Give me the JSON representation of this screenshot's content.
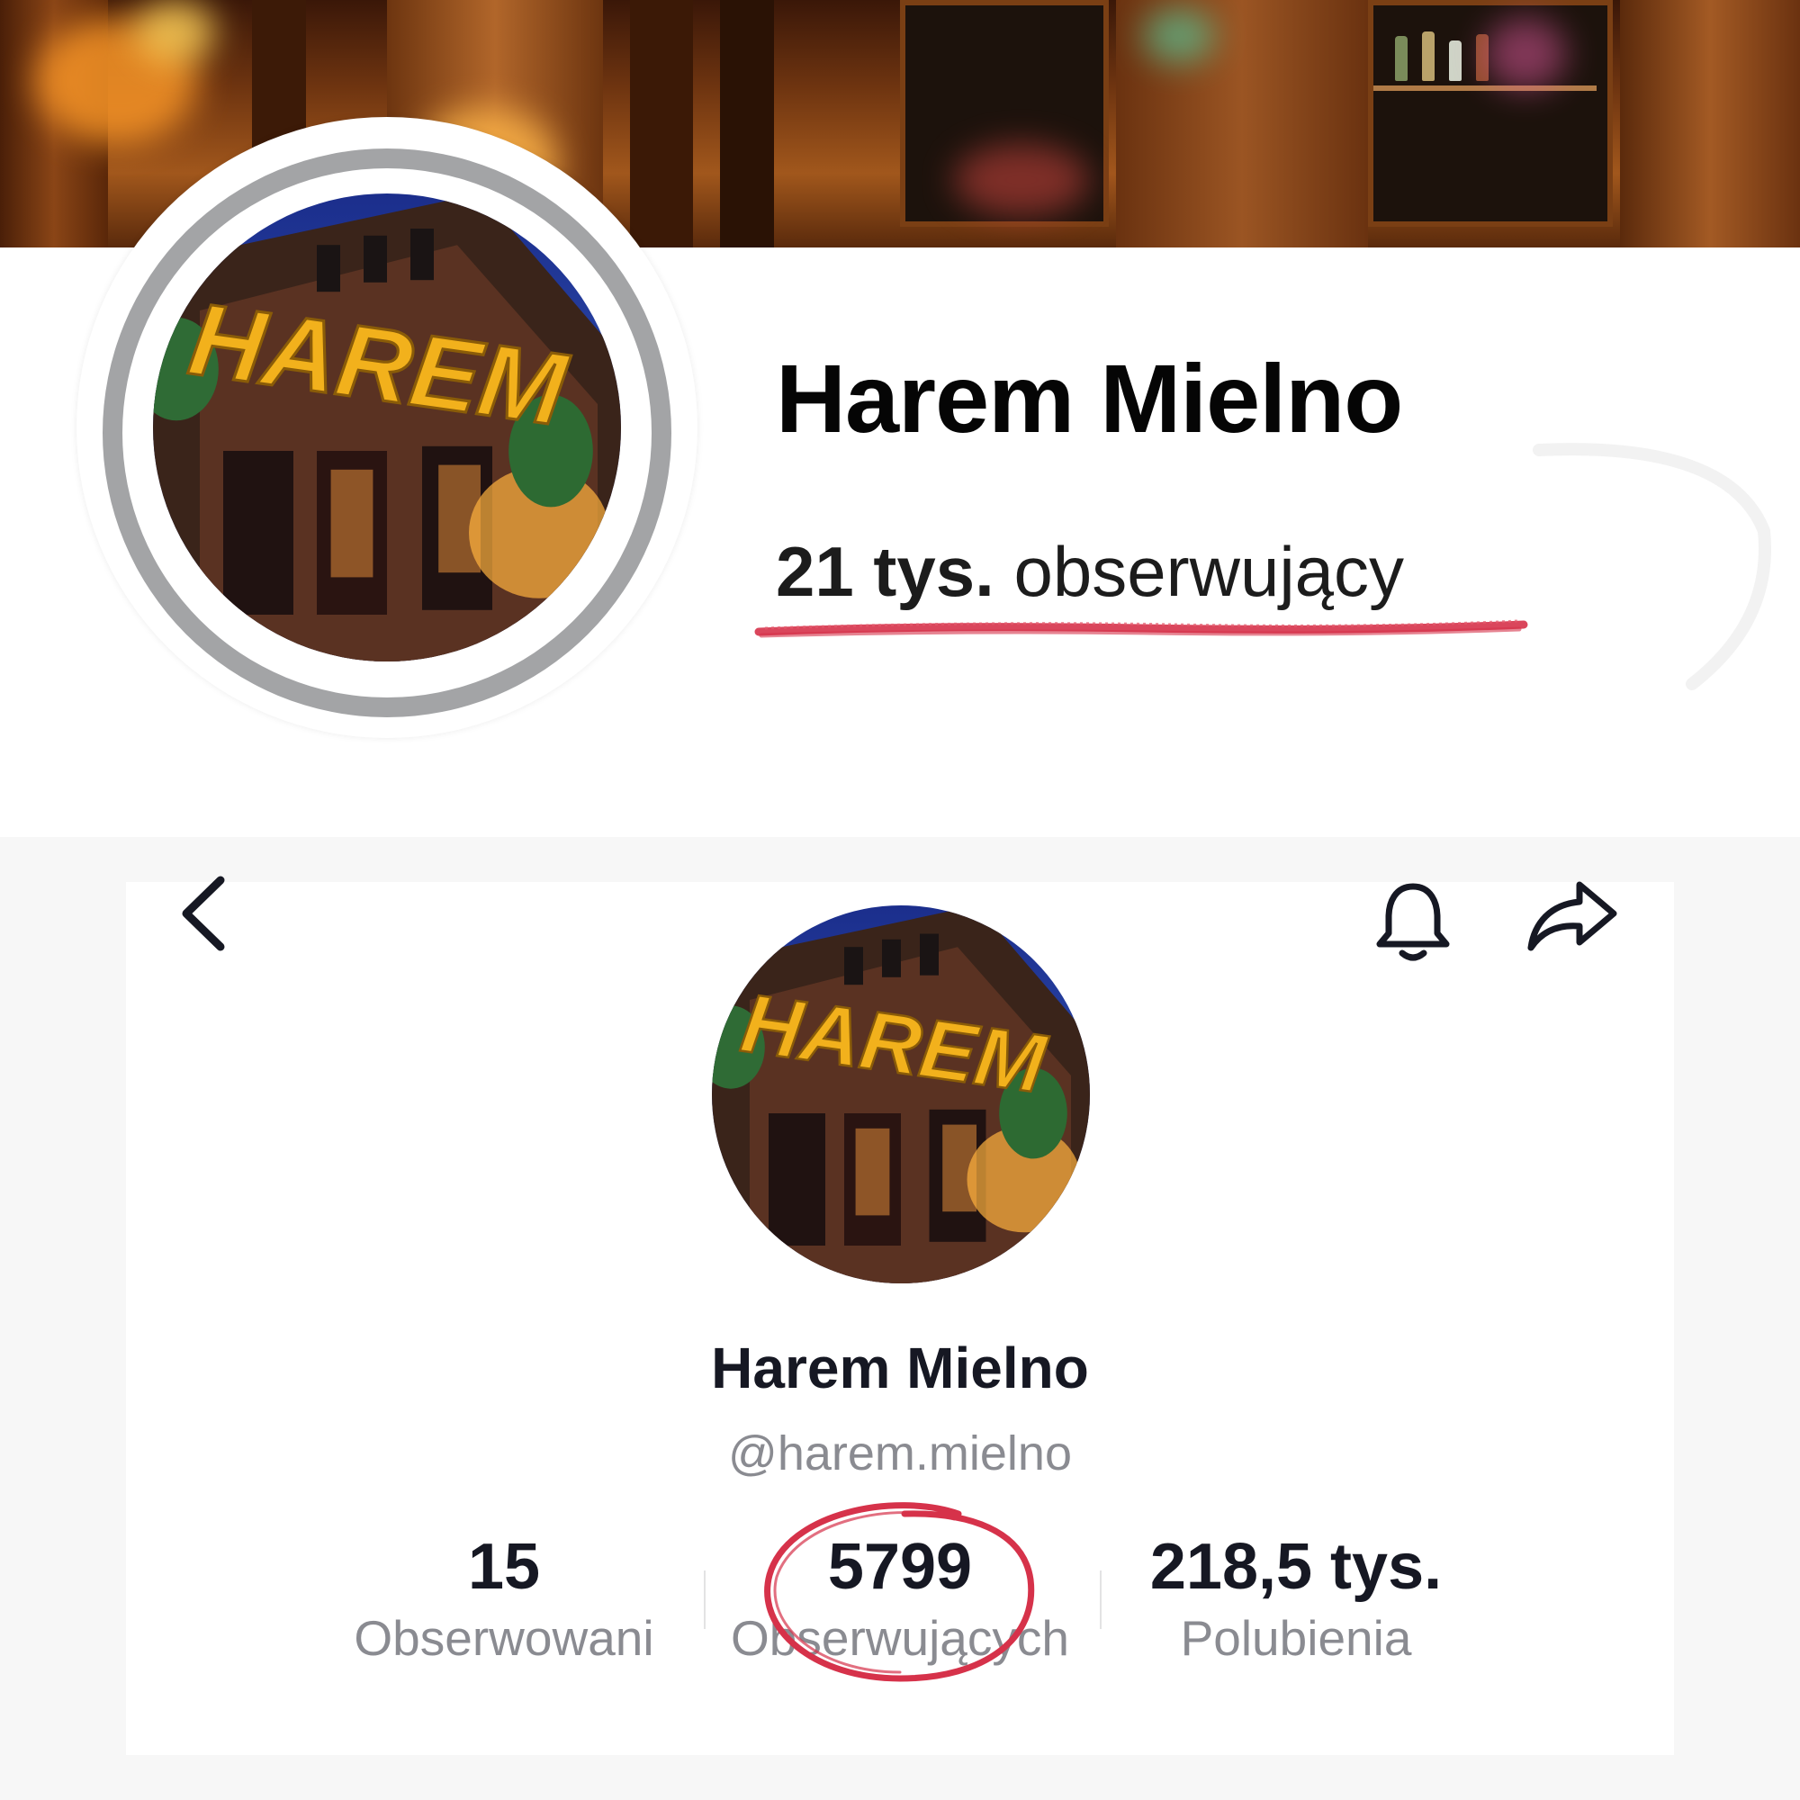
{
  "facebook": {
    "name": "Harem Mielno",
    "followers_count": "21 tys.",
    "followers_label": "obserwujący",
    "avatar_sign_text": "HAREM"
  },
  "tiktok": {
    "name": "Harem Mielno",
    "handle": "@harem.mielno",
    "avatar_sign_text": "HAREM",
    "stats": [
      {
        "value": "15",
        "label": "Obserwowani"
      },
      {
        "value": "5799",
        "label": "Obserwujących"
      },
      {
        "value": "218,5 tys.",
        "label": "Polubienia"
      }
    ],
    "icons": [
      "back-icon",
      "bell-icon",
      "share-icon"
    ]
  },
  "colors": {
    "annotation_red": "#d6324a",
    "ring_gray": "#a3a4a6",
    "sign_yellow": "#f2b11c"
  }
}
